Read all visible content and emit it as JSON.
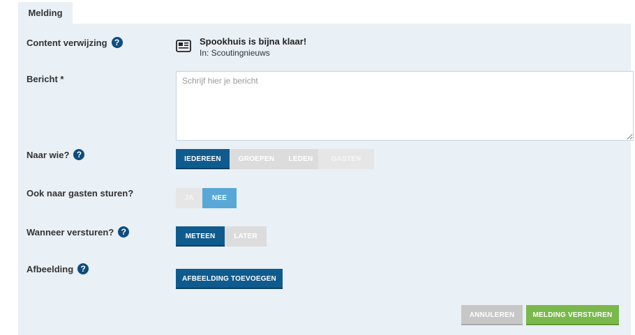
{
  "tab": {
    "label": "Melding"
  },
  "form": {
    "content_ref": {
      "label": "Content verwijzing",
      "title": "Spookhuis is bijna klaar!",
      "subtitle": "In: Scoutingnieuws"
    },
    "message": {
      "label": "Bericht *",
      "placeholder": "Schrijf hier je bericht",
      "value": ""
    },
    "recipients": {
      "label": "Naar wie?",
      "options": [
        "IEDEREEN",
        "GROEPEN",
        "LEDEN",
        "GASTEN"
      ],
      "selected": "IEDEREEN"
    },
    "guests": {
      "label": "Ook naar gasten sturen?",
      "options": [
        "JA",
        "NEE"
      ],
      "selected": "NEE"
    },
    "when": {
      "label": "Wanneer versturen?",
      "options": [
        "METEEN",
        "LATER"
      ],
      "selected": "METEEN"
    },
    "image": {
      "label": "Afbeelding",
      "button": "AFBEELDING TOEVOEGEN"
    }
  },
  "actions": {
    "cancel": "ANNULEREN",
    "send": "MELDING VERSTUREN"
  },
  "help_glyph": "?",
  "colors": {
    "primary": "#0f5b8e",
    "accent_light": "#57a8d6",
    "send": "#79b84a",
    "cancel": "#c7c7c7",
    "panel": "#e9f0f6"
  }
}
